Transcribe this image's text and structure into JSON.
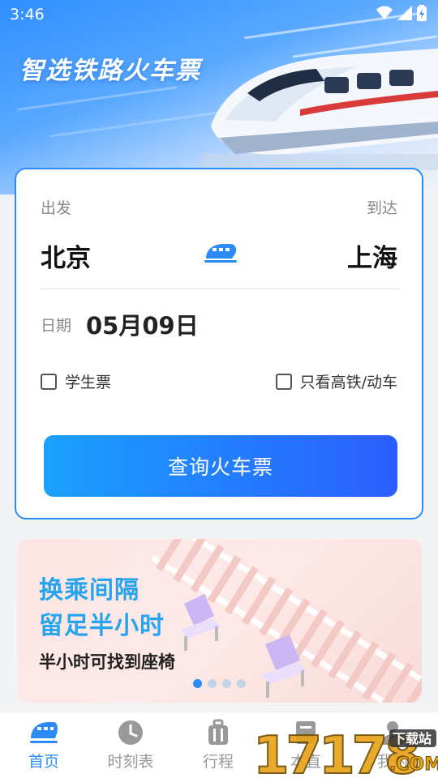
{
  "status": {
    "time": "3:46"
  },
  "hero": {
    "title": "智选铁路火车票"
  },
  "search": {
    "depart_label": "出发",
    "arrive_label": "到达",
    "from_city": "北京",
    "to_city": "上海",
    "date_label": "日期",
    "date_value": "05月09日",
    "student_label": "学生票",
    "highspeed_label": "只看高铁/动车",
    "button_label": "查询火车票"
  },
  "banner": {
    "line1": "换乘间隔",
    "line2": "留足半小时",
    "subtitle": "半小时可找到座椅",
    "dots_total": 4,
    "active_dot": 0
  },
  "nav": {
    "items": [
      {
        "label": "首页",
        "icon": "train-icon",
        "active": true
      },
      {
        "label": "时刻表",
        "icon": "clock-icon",
        "active": false
      },
      {
        "label": "行程",
        "icon": "luggage-icon",
        "active": false
      },
      {
        "label": "本直",
        "icon": "book-icon",
        "active": false
      },
      {
        "label": "我的",
        "icon": "user-icon",
        "active": false
      }
    ]
  },
  "watermark": {
    "text": "17178",
    "tag": "下载站",
    "suffix": ".COM"
  },
  "colors": {
    "accent": "#2b8cf7",
    "banner_heading": "#27a4ee",
    "button_start": "#1aa1ff",
    "button_end": "#2b5dff"
  }
}
